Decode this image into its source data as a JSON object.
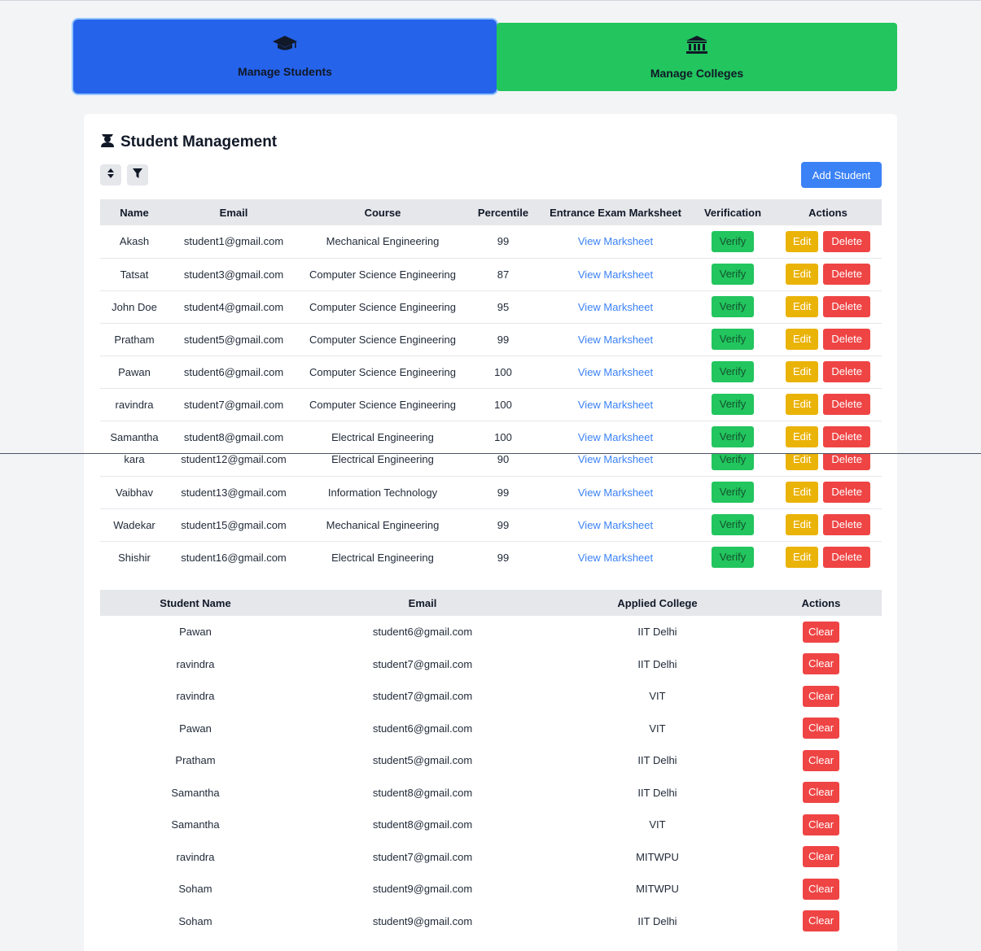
{
  "nav": {
    "students_label": "Manage Students",
    "colleges_label": "Manage Colleges"
  },
  "panel": {
    "title": "Student Management",
    "add_button": "Add Student"
  },
  "students_table": {
    "headers": [
      "Name",
      "Email",
      "Course",
      "Percentile",
      "Entrance Exam Marksheet",
      "Verification",
      "Actions"
    ],
    "link_label": "View Marksheet",
    "verify_label": "Verify",
    "edit_label": "Edit",
    "delete_label": "Delete",
    "rows": [
      {
        "name": "Akash",
        "email": "student1@gmail.com",
        "course": "Mechanical Engineering",
        "percentile": "99"
      },
      {
        "name": "Tatsat",
        "email": "student3@gmail.com",
        "course": "Computer Science Engineering",
        "percentile": "87"
      },
      {
        "name": "John Doe",
        "email": "student4@gmail.com",
        "course": "Computer Science Engineering",
        "percentile": "95"
      },
      {
        "name": "Pratham",
        "email": "student5@gmail.com",
        "course": "Computer Science Engineering",
        "percentile": "99"
      },
      {
        "name": "Pawan",
        "email": "student6@gmail.com",
        "course": "Computer Science Engineering",
        "percentile": "100"
      },
      {
        "name": "ravindra",
        "email": "student7@gmail.com",
        "course": "Computer Science Engineering",
        "percentile": "100"
      },
      {
        "name": "Samantha",
        "email": "student8@gmail.com",
        "course": "Electrical Engineering",
        "percentile": "100"
      }
    ],
    "rows_after_split": [
      {
        "name": "kara",
        "email": "student12@gmail.com",
        "course": "Electrical Engineering",
        "percentile": "90"
      },
      {
        "name": "Vaibhav",
        "email": "student13@gmail.com",
        "course": "Information Technology",
        "percentile": "99"
      },
      {
        "name": "Wadekar",
        "email": "student15@gmail.com",
        "course": "Mechanical Engineering",
        "percentile": "99"
      },
      {
        "name": "Shishir",
        "email": "student16@gmail.com",
        "course": "Electrical Engineering",
        "percentile": "99"
      }
    ]
  },
  "applications_table": {
    "headers": [
      "Student Name",
      "Email",
      "Applied College",
      "Actions"
    ],
    "clear_label": "Clear",
    "rows": [
      {
        "name": "Pawan",
        "email": "student6@gmail.com",
        "college": "IIT Delhi"
      },
      {
        "name": "ravindra",
        "email": "student7@gmail.com",
        "college": "IIT Delhi"
      },
      {
        "name": "ravindra",
        "email": "student7@gmail.com",
        "college": "VIT"
      },
      {
        "name": "Pawan",
        "email": "student6@gmail.com",
        "college": "VIT"
      },
      {
        "name": "Pratham",
        "email": "student5@gmail.com",
        "college": "IIT Delhi"
      },
      {
        "name": "Samantha",
        "email": "student8@gmail.com",
        "college": "IIT Delhi"
      },
      {
        "name": "Samantha",
        "email": "student8@gmail.com",
        "college": "VIT"
      },
      {
        "name": "ravindra",
        "email": "student7@gmail.com",
        "college": "MITWPU"
      },
      {
        "name": "Soham",
        "email": "student9@gmail.com",
        "college": "MITWPU"
      },
      {
        "name": "Soham",
        "email": "student9@gmail.com",
        "college": "IIT Delhi"
      }
    ]
  },
  "colors": {
    "primary": "#2563eb",
    "success": "#22c55e",
    "warning": "#eab308",
    "danger": "#ef4444",
    "link": "#3b82f6"
  },
  "icons": {
    "students": "graduation-cap-icon",
    "colleges": "university-icon",
    "title": "user-graduate-icon",
    "sort": "sort-icon",
    "filter": "filter-icon"
  }
}
